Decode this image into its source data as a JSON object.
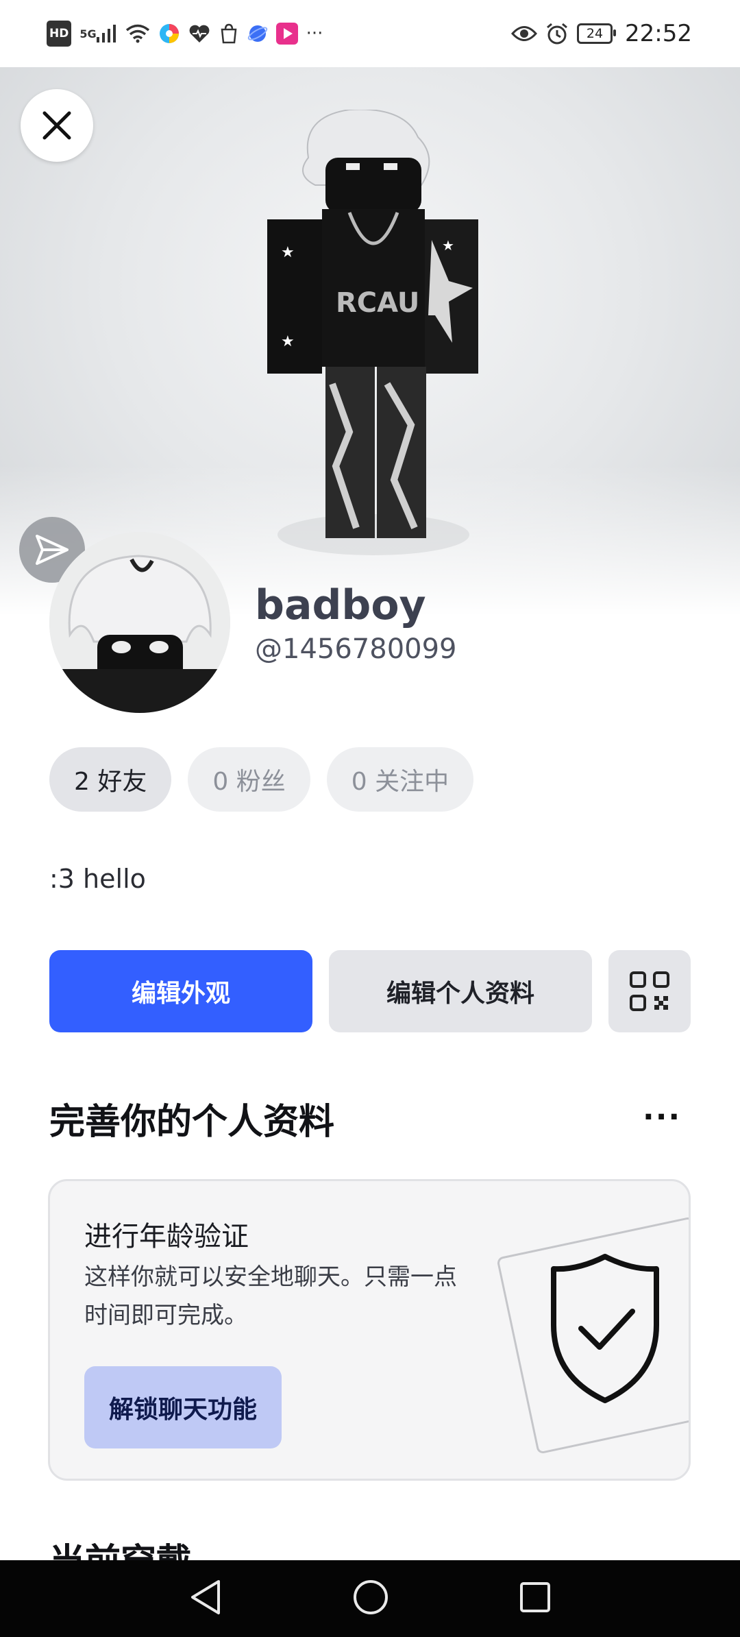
{
  "status_bar": {
    "hd": "HD",
    "signal": "5G",
    "battery": "24",
    "time": "22:52",
    "more": "···"
  },
  "profile": {
    "display_name": "badboy",
    "username": "@1456780099",
    "bio": ":3 hello",
    "stats": [
      {
        "label": "2 好友"
      },
      {
        "label": "0 粉丝"
      },
      {
        "label": "0 关注中"
      }
    ]
  },
  "actions": {
    "edit_avatar": "编辑外观",
    "edit_profile": "编辑个人资料"
  },
  "complete_profile": {
    "title": "完善你的个人资料",
    "more": "···",
    "card": {
      "title": "进行年龄验证",
      "description": "这样你就可以安全地聊天。只需一点时间即可完成。",
      "button": "解锁聊天功能"
    }
  },
  "next_section": {
    "title": "当前穿戴"
  },
  "colors": {
    "primary": "#335fff",
    "card_button": "#bfc9f5"
  }
}
